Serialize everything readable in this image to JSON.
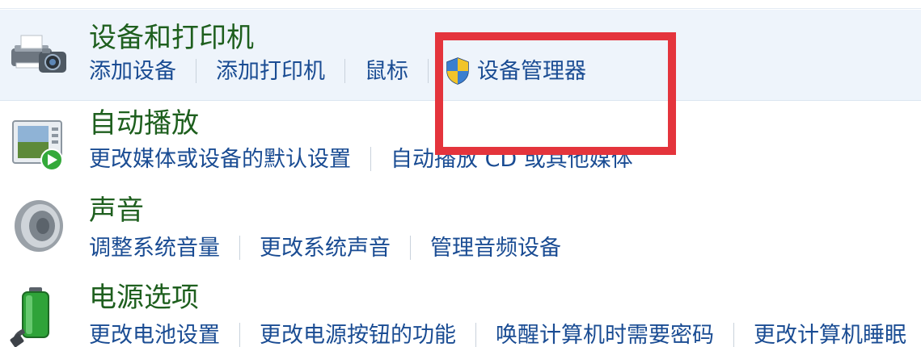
{
  "sections": [
    {
      "title": "设备和打印机",
      "links": [
        "添加设备",
        "添加打印机",
        "鼠标",
        "设备管理器"
      ]
    },
    {
      "title": "自动播放",
      "links": [
        "更改媒体或设备的默认设置",
        "自动播放 CD 或其他媒体"
      ]
    },
    {
      "title": "声音",
      "links": [
        "调整系统音量",
        "更改系统声音",
        "管理音频设备"
      ]
    },
    {
      "title": "电源选项",
      "links": [
        "更改电池设置",
        "更改电源按钮的功能",
        "唤醒计算机时需要密码",
        "更改计算机睡眠"
      ]
    }
  ],
  "colors": {
    "title": "#1e5f1e",
    "link": "#1a4c93",
    "highlight_bg": "#eef4fb",
    "annotation_box": "#e4343c"
  },
  "icons": {
    "section0": "printer-camera-icon",
    "section1": "autoplay-icon",
    "section2": "speaker-icon",
    "section3": "battery-power-icon",
    "uac": "uac-shield-icon"
  }
}
